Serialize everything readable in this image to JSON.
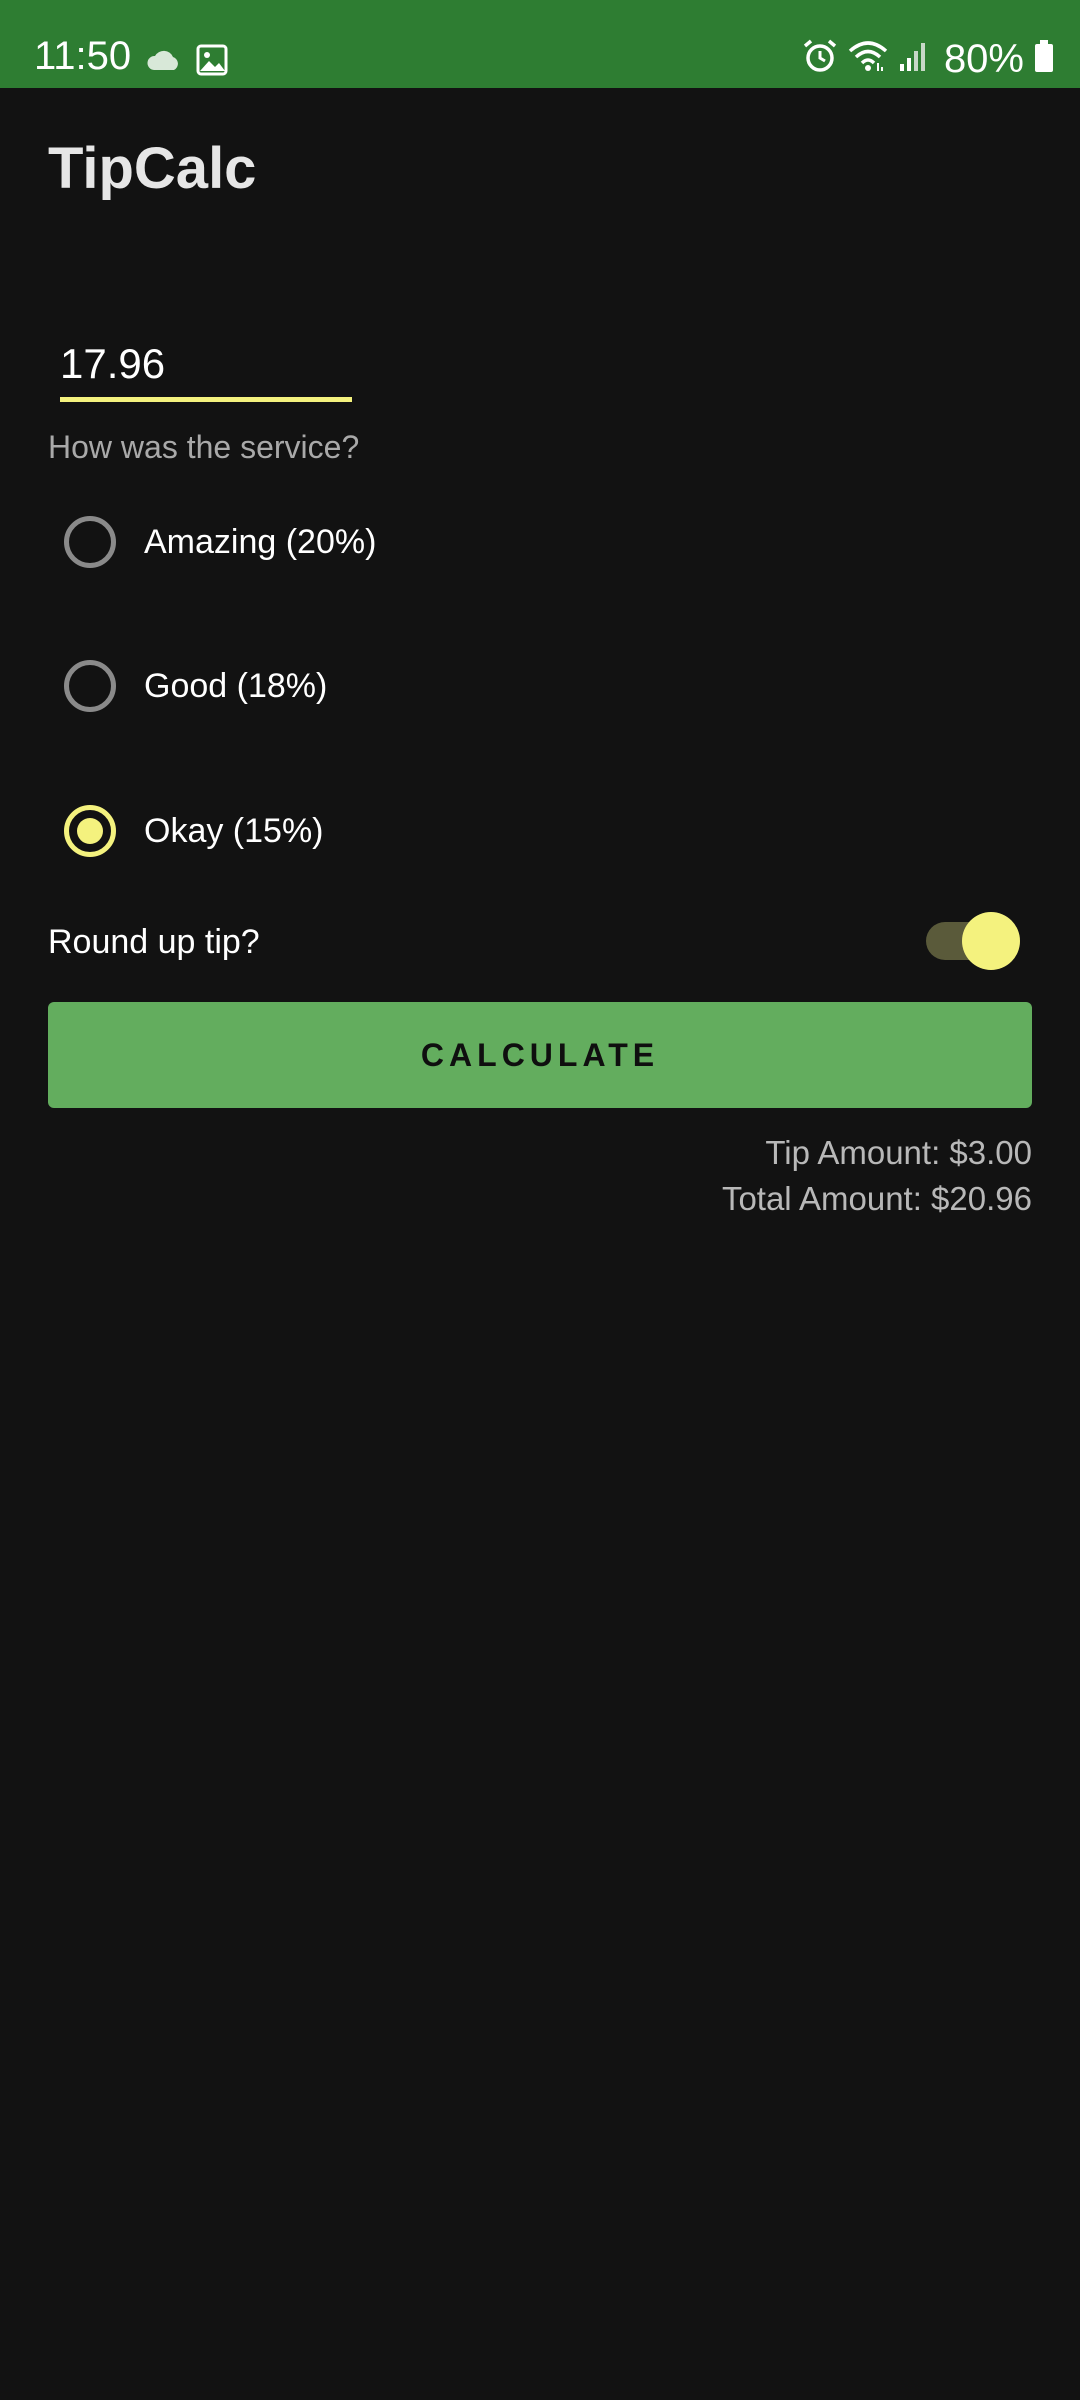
{
  "status_bar": {
    "time": "11:50",
    "battery": "80%",
    "left_icons": [
      "cloud-icon",
      "image-icon"
    ],
    "right_icons": [
      "alarm-icon",
      "wifi-icon",
      "signal-icon",
      "battery-icon"
    ]
  },
  "app": {
    "title": "TipCalc"
  },
  "bill_input": {
    "value": "17.96"
  },
  "service": {
    "question": "How was the service?",
    "options": [
      {
        "label": "Amazing (20%)",
        "checked": false
      },
      {
        "label": "Good (18%)",
        "checked": false
      },
      {
        "label": "Okay (15%)",
        "checked": true
      }
    ]
  },
  "round_up": {
    "label": "Round up tip?",
    "enabled": true
  },
  "calculate_button": {
    "label": "CALCULATE"
  },
  "results": {
    "tip": "Tip Amount: $3.00",
    "total": "Total Amount: $20.96"
  },
  "colors": {
    "status_bar": "#2e7d32",
    "background": "#121212",
    "accent": "#f4f27e",
    "button": "#63ad5e"
  }
}
